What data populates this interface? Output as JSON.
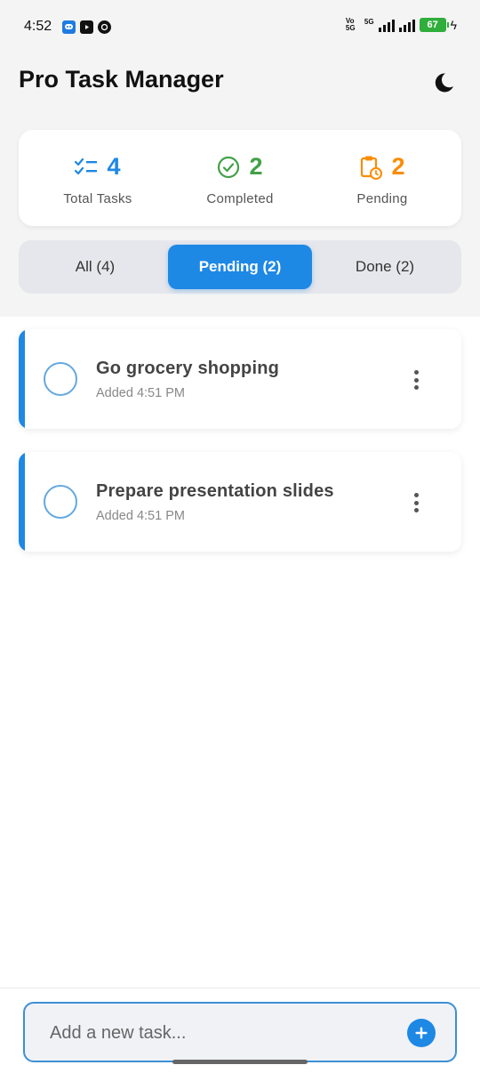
{
  "status_bar": {
    "time": "4:52",
    "network": "5G",
    "volte": "Vo 5G",
    "battery": "67"
  },
  "header": {
    "title": "Pro Task Manager",
    "theme_icon": "moon-icon"
  },
  "stats": [
    {
      "value": "4",
      "label": "Total Tasks",
      "icon": "checklist-icon",
      "color": "#1e88e5"
    },
    {
      "value": "2",
      "label": "Completed",
      "icon": "check-circle-icon",
      "color": "#43a047"
    },
    {
      "value": "2",
      "label": "Pending",
      "icon": "clipboard-clock-icon",
      "color": "#fb8c00"
    }
  ],
  "tabs": [
    {
      "label": "All (4)",
      "active": false
    },
    {
      "label": "Pending (2)",
      "active": true
    },
    {
      "label": "Done (2)",
      "active": false
    }
  ],
  "tasks": [
    {
      "title": "Go grocery shopping",
      "time": "Added 4:51 PM"
    },
    {
      "title": "Prepare presentation slides",
      "time": "Added 4:51 PM"
    }
  ],
  "input": {
    "placeholder": "Add a new task...",
    "value": ""
  },
  "colors": {
    "accent": "#1e88e5",
    "completed": "#43a047",
    "pending": "#fb8c00"
  }
}
